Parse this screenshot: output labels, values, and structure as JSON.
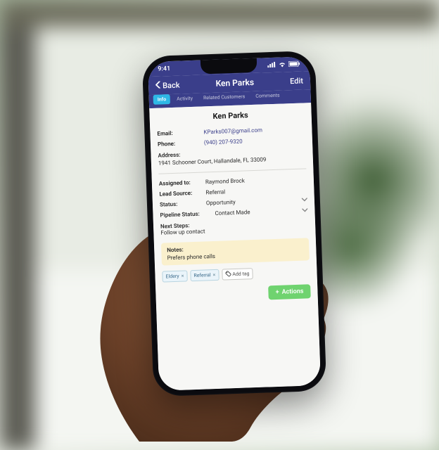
{
  "statusBar": {
    "time": "9:41"
  },
  "nav": {
    "back": "Back",
    "title": "Ken Parks",
    "edit": "Edit"
  },
  "tabs": {
    "info": "Info",
    "activity": "Activity",
    "related": "Related Customers",
    "comments": "Comments"
  },
  "contact": {
    "name": "Ken Parks",
    "emailLabel": "Email:",
    "email": "KParks007@gmail.com",
    "phoneLabel": "Phone:",
    "phone": "(940) 207-9320",
    "addressLabel": "Address:",
    "address": "1941 Schooner Court, Hallandale, FL 33009"
  },
  "details": {
    "assignedLabel": "Assigned to:",
    "assigned": "Raymond Brock",
    "leadSourceLabel": "Lead Source:",
    "leadSource": "Referral",
    "statusLabel": "Status:",
    "status": "Opportunity",
    "pipelineLabel": "Pipeline Status:",
    "pipeline": "Contact Made",
    "nextLabel": "Next Steps:",
    "next": "Follow up contact"
  },
  "notes": {
    "label": "Notes:",
    "text": "Prefers phone calls"
  },
  "tags": {
    "t1": "Eldery",
    "t2": "Referral",
    "add": "Add tag"
  },
  "actions": {
    "label": "Actions"
  }
}
